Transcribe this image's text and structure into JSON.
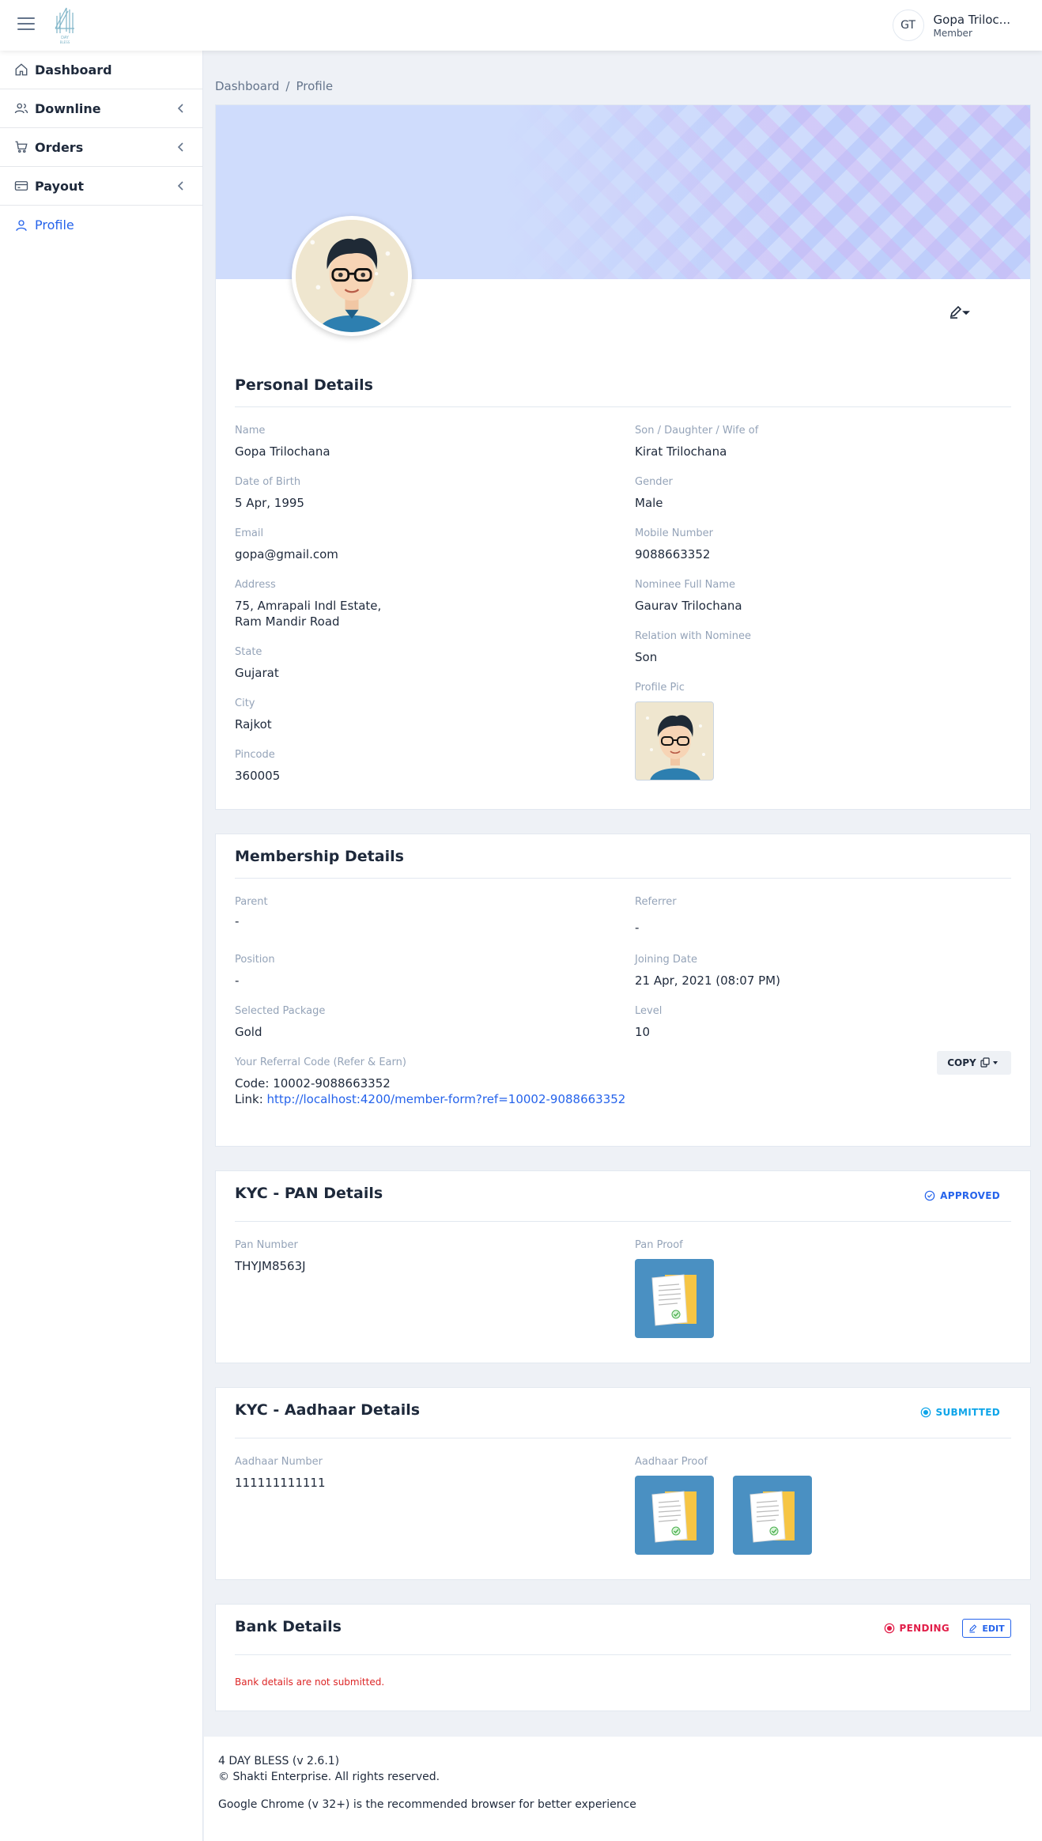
{
  "header": {
    "avatar_initials": "GT",
    "user_name": "Gopa Triloc...",
    "user_role": "Member"
  },
  "sidebar": {
    "items": [
      {
        "label": "Dashboard",
        "icon": "home-icon"
      },
      {
        "label": "Downline",
        "icon": "users-icon"
      },
      {
        "label": "Orders",
        "icon": "cart-icon"
      },
      {
        "label": "Payout",
        "icon": "card-icon"
      },
      {
        "label": "Profile",
        "icon": "user-icon"
      }
    ]
  },
  "breadcrumb": {
    "root": "Dashboard",
    "separator": "/",
    "current": "Profile"
  },
  "personal": {
    "title": "Personal Details",
    "name_label": "Name",
    "name": "Gopa Trilochana",
    "dob_label": "Date of Birth",
    "dob": "5 Apr, 1995",
    "email_label": "Email",
    "email": "gopa@gmail.com",
    "address_label": "Address",
    "address_line1": "75, Amrapali Indl Estate,",
    "address_line2": "Ram Mandir Road",
    "state_label": "State",
    "state": "Gujarat",
    "city_label": "City",
    "city": "Rajkot",
    "pincode_label": "Pincode",
    "pincode": "360005",
    "relation_label": "Son / Daughter / Wife of",
    "relation": "Kirat Trilochana",
    "gender_label": "Gender",
    "gender": "Male",
    "mobile_label": "Mobile Number",
    "mobile": "9088663352",
    "nominee_label": "Nominee Full Name",
    "nominee": "Gaurav Trilochana",
    "nominee_relation_label": "Relation with Nominee",
    "nominee_relation": "Son",
    "profile_pic_label": "Profile Pic"
  },
  "membership": {
    "title": "Membership Details",
    "parent_label": "Parent",
    "parent": "-",
    "referrer_label": "Referrer",
    "referrer": "-",
    "position_label": "Position",
    "position": "-",
    "joining_label": "Joining Date",
    "joining": "21 Apr, 2021 (08:07 PM)",
    "package_label": "Selected Package",
    "package": "Gold",
    "level_label": "Level",
    "level": "10",
    "referral_label": "Your Referral Code (Refer & Earn)",
    "code_text": "Code: 10002-9088663352",
    "link_prefix": "Link: ",
    "link_url": "http://localhost:4200/member-form?ref=10002-9088663352",
    "copy_label": "COPY"
  },
  "kyc_pan": {
    "title": "KYC - PAN Details",
    "status": "APPROVED",
    "status_color": "#2563eb",
    "pan_label": "Pan Number",
    "pan": "THYJM8563J",
    "proof_label": "Pan Proof"
  },
  "kyc_aadhaar": {
    "title": "KYC - Aadhaar Details",
    "status": "SUBMITTED",
    "status_color": "#0ea5e9",
    "aadhaar_label": "Aadhaar Number",
    "aadhaar": "111111111111",
    "proof_label": "Aadhaar Proof"
  },
  "bank": {
    "title": "Bank Details",
    "status": "PENDING",
    "status_color": "#e11d48",
    "edit_label": "EDIT",
    "message": "Bank details are not submitted."
  },
  "footer": {
    "line1": "4 DAY BLESS (v 2.6.1)",
    "line2": "© Shakti Enterprise. All rights reserved.",
    "line3": "Google Chrome (v 32+) is the recommended browser for better experience"
  },
  "colors": {
    "accent": "#2563eb",
    "error": "#dc2626",
    "page_bg": "#eef1f6"
  }
}
